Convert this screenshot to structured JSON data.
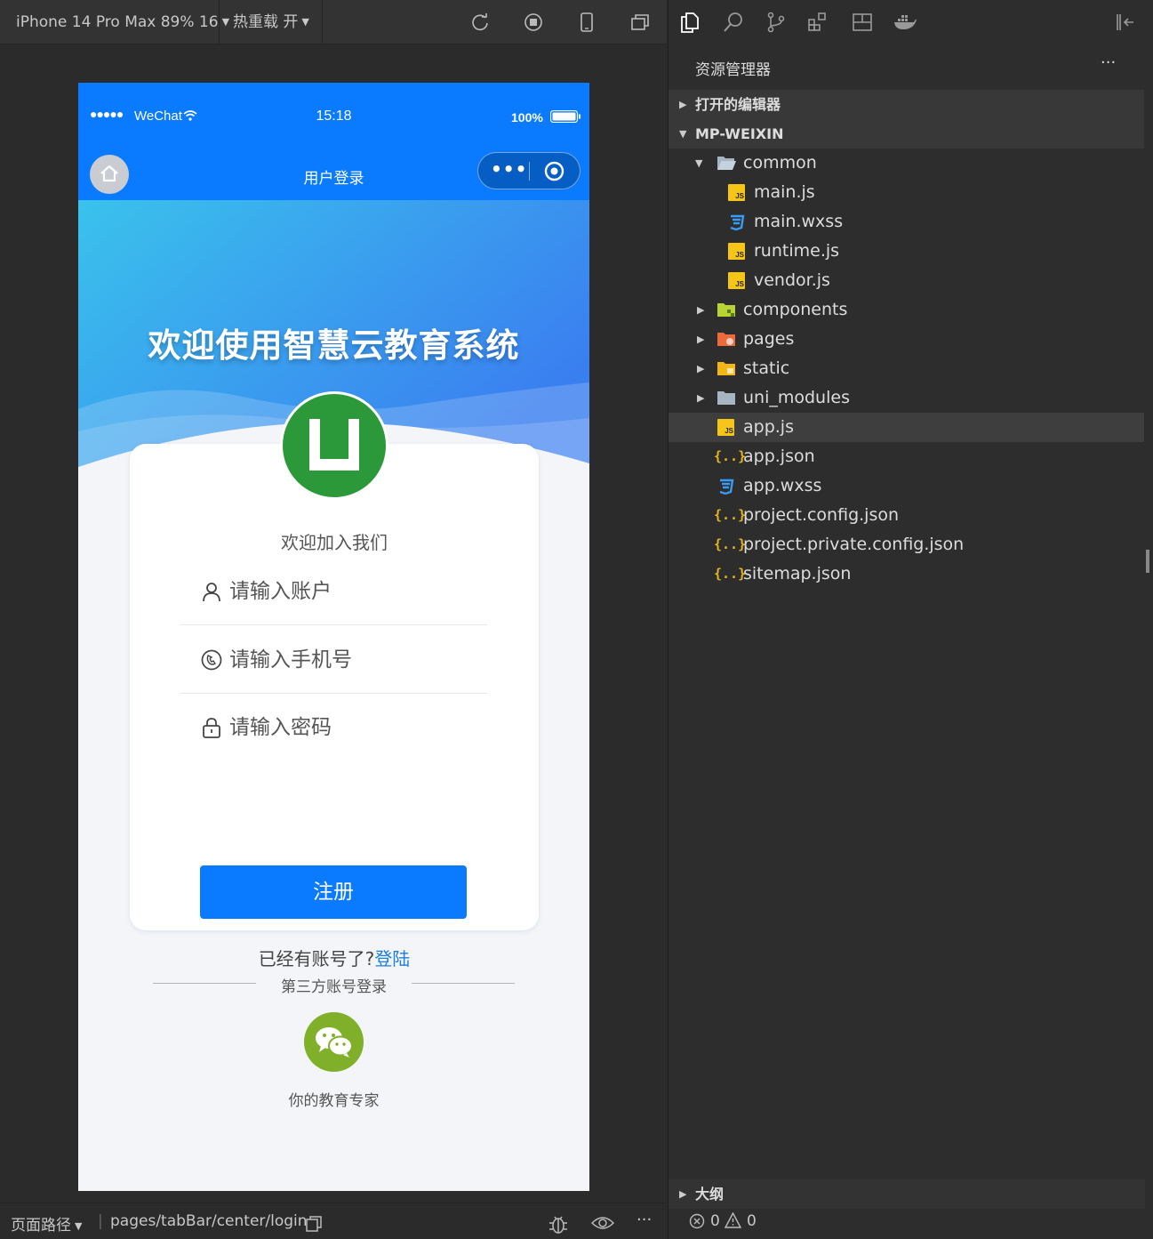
{
  "simulator_toolbar": {
    "device_label": "iPhone 14 Pro Max 89% 16",
    "hot_reload_label": "热重载 开",
    "icons": [
      "refresh-icon",
      "stop-icon",
      "phone-icon",
      "detach-window-icon"
    ]
  },
  "status_bar": {
    "signal": "●●●●●",
    "carrier": "WeChat",
    "time": "15:18",
    "battery": "100%"
  },
  "nav_bar": {
    "title": "用户登录",
    "capsule_more": "•••"
  },
  "hero": {
    "title": "欢迎使用智慧云教育系统"
  },
  "login_card": {
    "welcome": "欢迎加入我们",
    "fields": {
      "account": {
        "placeholder": "请输入账户"
      },
      "phone": {
        "placeholder": "请输入手机号"
      },
      "password": {
        "placeholder": "请输入密码"
      }
    },
    "register_button": "注册",
    "already_text": "已经有账号了?",
    "login_link": "登陆"
  },
  "third_party": {
    "divider_label": "第三方账号登录",
    "wechat_caption": "你的教育专家"
  },
  "explorer": {
    "title": "资源管理器",
    "more": "···",
    "sections": {
      "open_editors": "打开的编辑器",
      "project": "MP-WEIXIN",
      "outline": "大纲"
    },
    "tree": [
      {
        "name": "common",
        "type": "folder-open"
      },
      {
        "name": "main.js",
        "type": "js"
      },
      {
        "name": "main.wxss",
        "type": "css"
      },
      {
        "name": "runtime.js",
        "type": "js"
      },
      {
        "name": "vendor.js",
        "type": "js"
      },
      {
        "name": "components",
        "type": "folder"
      },
      {
        "name": "pages",
        "type": "folder"
      },
      {
        "name": "static",
        "type": "folder"
      },
      {
        "name": "uni_modules",
        "type": "folder"
      },
      {
        "name": "app.js",
        "type": "js"
      },
      {
        "name": "app.json",
        "type": "json"
      },
      {
        "name": "app.wxss",
        "type": "css"
      },
      {
        "name": "project.config.json",
        "type": "json"
      },
      {
        "name": "project.private.config.json",
        "type": "json"
      },
      {
        "name": "sitemap.json",
        "type": "json"
      }
    ],
    "badges": {
      "js": "JS",
      "json": "{..}"
    }
  },
  "bottom_bar": {
    "page_path_label": "页面路径",
    "separator": "|",
    "path": "pages/tabBar/center/login",
    "more": "···"
  },
  "problems": {
    "errors": "0",
    "warnings": "0"
  },
  "colors": {
    "accent": "#0a7bff",
    "link": "#1a7fe0",
    "logo_green": "#2b9939",
    "wechat_green": "#80b02a",
    "js_yellow": "#f5c518"
  }
}
